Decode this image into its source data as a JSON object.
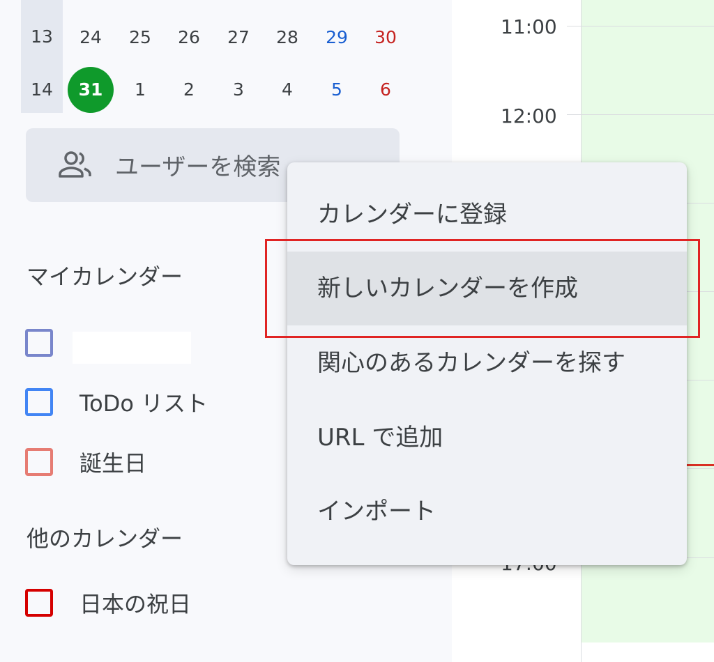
{
  "mini_calendar": {
    "week_numbers": [
      "13",
      "14"
    ],
    "rows": [
      [
        "24",
        "25",
        "26",
        "27",
        "28",
        "29",
        "30"
      ],
      [
        "31",
        "1",
        "2",
        "3",
        "4",
        "5",
        "6"
      ]
    ],
    "today": "31"
  },
  "search": {
    "label": "ユーザーを検索",
    "icon": "people-icon"
  },
  "my_calendars": {
    "title": "マイカレンダー",
    "items": [
      {
        "label": "",
        "color": "#7986cb"
      },
      {
        "label": "ToDo リスト",
        "color": "#4285f4"
      },
      {
        "label": "誕生日",
        "color": "#e67c73"
      }
    ]
  },
  "other_calendars": {
    "title": "他のカレンダー",
    "items": [
      {
        "label": "日本の祝日",
        "color": "#d50000"
      }
    ]
  },
  "time_grid": {
    "labels": [
      "11:00",
      "12:00",
      "17:00"
    ]
  },
  "context_menu": {
    "items": [
      "カレンダーに登録",
      "新しいカレンダーを作成",
      "関心のあるカレンダーを探す",
      "URL で追加",
      "インポート"
    ],
    "hovered_index": 1
  },
  "colors": {
    "today": "#0f9a2b",
    "saturday": "#1a5fd1",
    "sunday": "#c5221f",
    "highlight_border": "#e02424",
    "event_bg": "#e8fbe7"
  }
}
